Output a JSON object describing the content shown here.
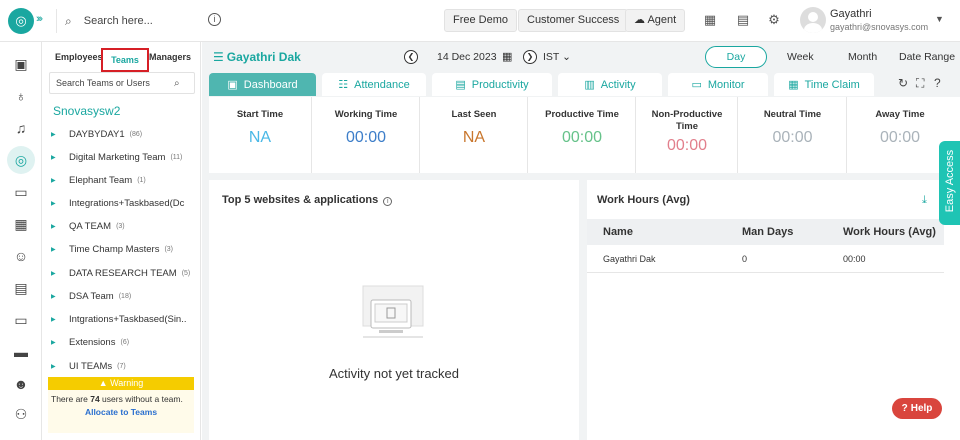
{
  "topbar": {
    "logo_icon": "timechamp-logo",
    "search_placeholder": "Search here...",
    "buttons": {
      "free_demo": "Free Demo",
      "customer_success": "Customer Success",
      "agent": "Agent"
    },
    "user": {
      "name": "Gayathri",
      "email": "gayathri@snovasys.com"
    }
  },
  "panel": {
    "tabs": {
      "employees": "Employees",
      "teams": "Teams",
      "managers": "Managers"
    },
    "search_placeholder": "Search Teams or Users",
    "org_name": "Snovasysw2",
    "teams": [
      {
        "name": "DAYBYDAY1",
        "count": "(86)"
      },
      {
        "name": "Digital Marketing Team",
        "count": "(11)"
      },
      {
        "name": "Elephant Team",
        "count": "(1)"
      },
      {
        "name": "Integrations+Taskbased(Dc",
        "count": ""
      },
      {
        "name": "QA TEAM",
        "count": "(3)"
      },
      {
        "name": "Time Champ Masters",
        "count": "(3)"
      },
      {
        "name": "DATA RESEARCH TEAM",
        "count": "(5)"
      },
      {
        "name": "DSA Team",
        "count": "(18)"
      },
      {
        "name": "Intgrations+Taskbased(Sin..",
        "count": ""
      },
      {
        "name": "Extensions",
        "count": "(6)"
      },
      {
        "name": "UI TEAMs",
        "count": "(7)"
      }
    ],
    "warning": {
      "title": "Warning",
      "text_prefix": "There are ",
      "count": "74",
      "text_suffix": " users without a team.",
      "link": "Allocate to Teams"
    }
  },
  "header": {
    "employee_name": "Gayathri Dak",
    "date": "14 Dec 2023",
    "timezone": "IST",
    "ranges": {
      "day": "Day",
      "week": "Week",
      "month": "Month",
      "date_range": "Date Range"
    }
  },
  "tabs": {
    "dashboard": "Dashboard",
    "attendance": "Attendance",
    "productivity": "Productivity",
    "activity": "Activity",
    "monitor": "Monitor",
    "time_claim": "Time Claim"
  },
  "stats": [
    {
      "label": "Start Time",
      "value": "NA",
      "color": "#4ab8e6"
    },
    {
      "label": "Working Time",
      "value": "00:00",
      "color": "#3d7ec9"
    },
    {
      "label": "Last Seen",
      "value": "NA",
      "color": "#c9772e"
    },
    {
      "label": "Productive Time",
      "value": "00:00",
      "color": "#66c28a"
    },
    {
      "label": "Non-Productive Time",
      "value": "00:00",
      "color": "#e27f8c"
    },
    {
      "label": "Neutral Time",
      "value": "00:00",
      "color": "#aab3ba"
    },
    {
      "label": "Away Time",
      "value": "00:00",
      "color": "#aab3ba"
    }
  ],
  "top_websites": {
    "title": "Top 5 websites & applications",
    "empty_text": "Activity not yet tracked"
  },
  "work_hours": {
    "title": "Work Hours (Avg)",
    "columns": {
      "name": "Name",
      "man_days": "Man Days",
      "work_hours": "Work Hours (Avg)"
    },
    "rows": [
      {
        "name": "Gayathri Dak",
        "man_days": "0",
        "work_hours": "00:00"
      }
    ]
  },
  "easy_access": "Easy Access",
  "help": "Help"
}
